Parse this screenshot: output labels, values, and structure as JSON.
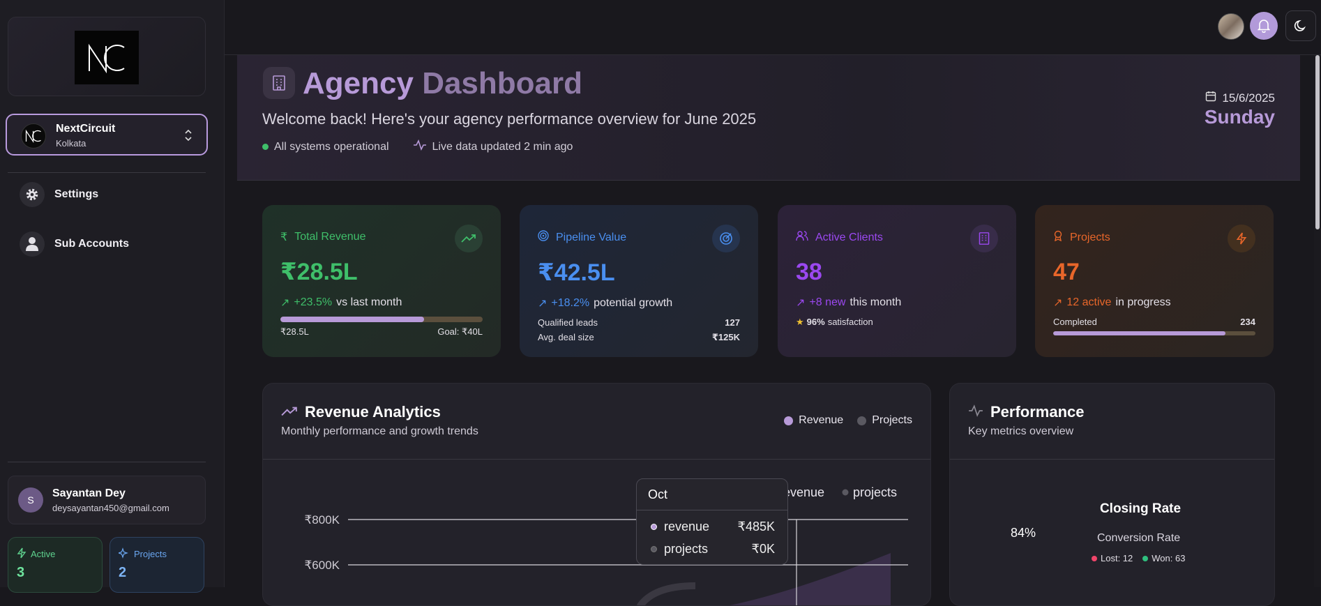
{
  "sidebar": {
    "account": {
      "name": "NextCircuit",
      "location": "Kolkata"
    },
    "nav": [
      {
        "label": "Settings",
        "icon": "gear-icon"
      },
      {
        "label": "Sub Accounts",
        "icon": "user-icon"
      }
    ],
    "user": {
      "initial": "S",
      "name": "Sayantan Dey",
      "email": "deysayantan450@gmail.com"
    },
    "mini": [
      {
        "label": "Active",
        "value": "3",
        "color": "#5fd38f"
      },
      {
        "label": "Projects",
        "value": "2",
        "color": "#6aa6f0"
      }
    ]
  },
  "hero": {
    "title_a": "Agency",
    "title_b": "Dashboard",
    "subtitle": "Welcome back! Here's your agency performance overview for June 2025",
    "status": "All systems operational",
    "live": "Live data updated 2 min ago",
    "date": "15/6/2025",
    "day": "Sunday"
  },
  "cards": [
    {
      "title": "Total Revenue",
      "value": "₹28.5L",
      "change": "+23.5%",
      "change_text": "vs last month",
      "left": "₹28.5L",
      "right": "Goal: ₹40L",
      "progress": 0.71,
      "accent": "#3fbf6a"
    },
    {
      "title": "Pipeline Value",
      "value": "₹42.5L",
      "change": "+18.2%",
      "change_text": "potential growth",
      "rows": [
        [
          "Qualified leads",
          "127"
        ],
        [
          "Avg. deal size",
          "₹125K"
        ]
      ],
      "accent": "#4a8ff0"
    },
    {
      "title": "Active Clients",
      "value": "38",
      "change": "+8 new",
      "change_text": "this month",
      "rating": "96%",
      "rating_text": "satisfaction",
      "accent": "#9b48f0"
    },
    {
      "title": "Projects",
      "value": "47",
      "change": "12 active",
      "change_text": "in progress",
      "left": "Completed",
      "right": "234",
      "progress": 0.85,
      "accent": "#e8662a"
    }
  ],
  "revenue": {
    "title": "Revenue Analytics",
    "subtitle": "Monthly performance and growth trends",
    "legend": [
      "Revenue",
      "Projects"
    ],
    "chart_legend": [
      "revenue",
      "projects"
    ],
    "yticks": [
      "₹800K",
      "₹600K"
    ],
    "tooltip": {
      "month": "Oct",
      "rows": [
        [
          "revenue",
          "₹485K"
        ],
        [
          "projects",
          "₹0K"
        ]
      ]
    }
  },
  "performance": {
    "title": "Performance",
    "subtitle": "Key metrics overview",
    "heading": "Closing Rate",
    "percent": "84%",
    "label": "Conversion Rate",
    "lost": "Lost: 12",
    "won": "Won: 63"
  }
}
